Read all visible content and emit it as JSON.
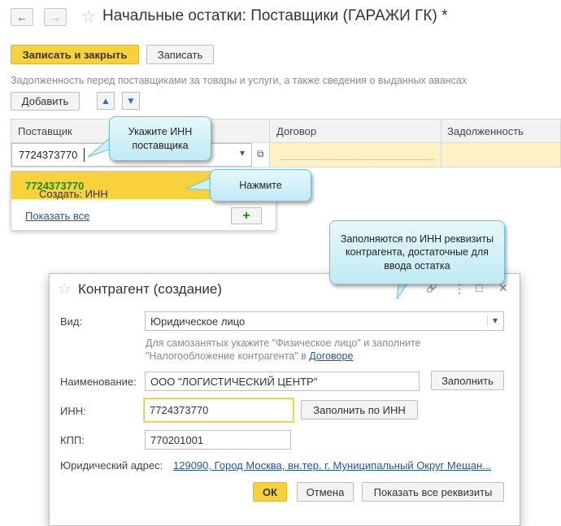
{
  "header": {
    "title": "Начальные остатки: Поставщики (ГАРАЖИ ГК) *",
    "back_icon": "←",
    "forward_icon": "→",
    "star_icon": "☆"
  },
  "toolbar": {
    "save_close_label": "Записать и закрыть",
    "save_label": "Записать"
  },
  "section_hint": "Задолженность перед поставщиками за товары и услуги, а также сведения о выданных авансах",
  "table_toolbar": {
    "add_label": "Добавить",
    "up_icon": "▲",
    "down_icon": "▼"
  },
  "table": {
    "columns": [
      "Поставщик",
      "Договор",
      "Задолженность"
    ],
    "row": {
      "supplier_value": "7724373770",
      "dropdown_arrow": "▾",
      "open_icon": "⧉"
    }
  },
  "dropdown": {
    "create_prefix": "Создать: ИНН ",
    "create_inn": "7724373770",
    "show_all_label": "Показать все",
    "add_icon": "+"
  },
  "callouts": {
    "enter_inn": "Укажите ИНН поставщика",
    "press": "Нажмите",
    "filled": "Заполняются по ИНН реквизиты контрагента, достаточные для ввода остатка"
  },
  "dialog": {
    "title": "Контрагент (создание)",
    "star_icon": "☆",
    "link_icon": "🔗",
    "menu_icon": "⋮",
    "maximize_icon": "□",
    "close_icon": "✕",
    "type_label": "Вид:",
    "type_value": "Юридическое лицо",
    "type_arrow": "▾",
    "type_hint_line1": "Для самозанятых укажите \"Физическое лицо\" и заполните",
    "type_hint_line2": "\"Налогообложение контрагента\" в ",
    "type_hint_link": "Договоре",
    "name_label": "Наименование:",
    "name_value": "ООО  \"ЛОГИСТИЧЕСКИЙ ЦЕНТР\"",
    "fill_label": "Заполнить",
    "inn_label": "ИНН:",
    "inn_value": "7724373770",
    "fill_inn_label": "Заполнить по ИНН",
    "kpp_label": "КПП:",
    "kpp_value": "770201001",
    "address_label": "Юридический адрес:",
    "address_value": "129090, Город Москва, вн.тер. г. Муниципальный Округ Мещан...",
    "ok_label": "ОК",
    "cancel_label": "Отмена",
    "show_all_label": "Показать все реквизиты"
  }
}
